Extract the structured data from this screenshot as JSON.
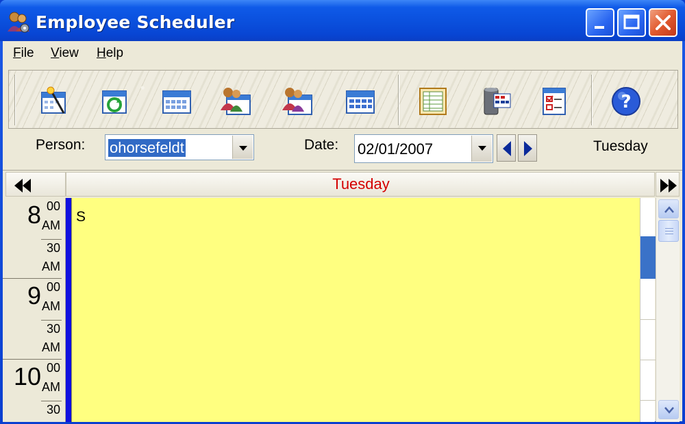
{
  "window": {
    "title": "Employee Scheduler",
    "app_icon": "people-gear-icon",
    "controls": [
      "minimize-icon",
      "maximize-icon",
      "close-icon"
    ]
  },
  "menu": {
    "items": [
      {
        "label": "File"
      },
      {
        "label": "View"
      },
      {
        "label": "Help"
      }
    ]
  },
  "toolbar": {
    "tools": [
      "calendar-wand-icon",
      "calendar-refresh-icon",
      "calendar-icon",
      "people-calendar-icon",
      "people-calendar-alt-icon",
      "calendar-grid-icon",
      "report-sheet-icon",
      "database-table-icon",
      "checklist-icon",
      "help-icon"
    ]
  },
  "filters": {
    "person_label": "Person:",
    "person_value": "ohorsefeldt",
    "date_label": "Date:",
    "date_value": "02/01/2007",
    "weekday_display": "Tuesday"
  },
  "schedule": {
    "day_header": "Tuesday",
    "hours": [
      {
        "hour": "8",
        "m00": "00",
        "am1": "AM",
        "m30": "30",
        "am2": "AM"
      },
      {
        "hour": "9",
        "m00": "00",
        "am1": "AM",
        "m30": "30",
        "am2": "AM"
      },
      {
        "hour": "10",
        "m00": "00",
        "am1": "AM",
        "m30": "30",
        "am2": ""
      }
    ],
    "event_text": "S"
  },
  "colors": {
    "title_bar": "#0a4fdc",
    "day_header_text": "#d40000",
    "day_area": "#ffff80",
    "person_bar": "#1010e0"
  }
}
